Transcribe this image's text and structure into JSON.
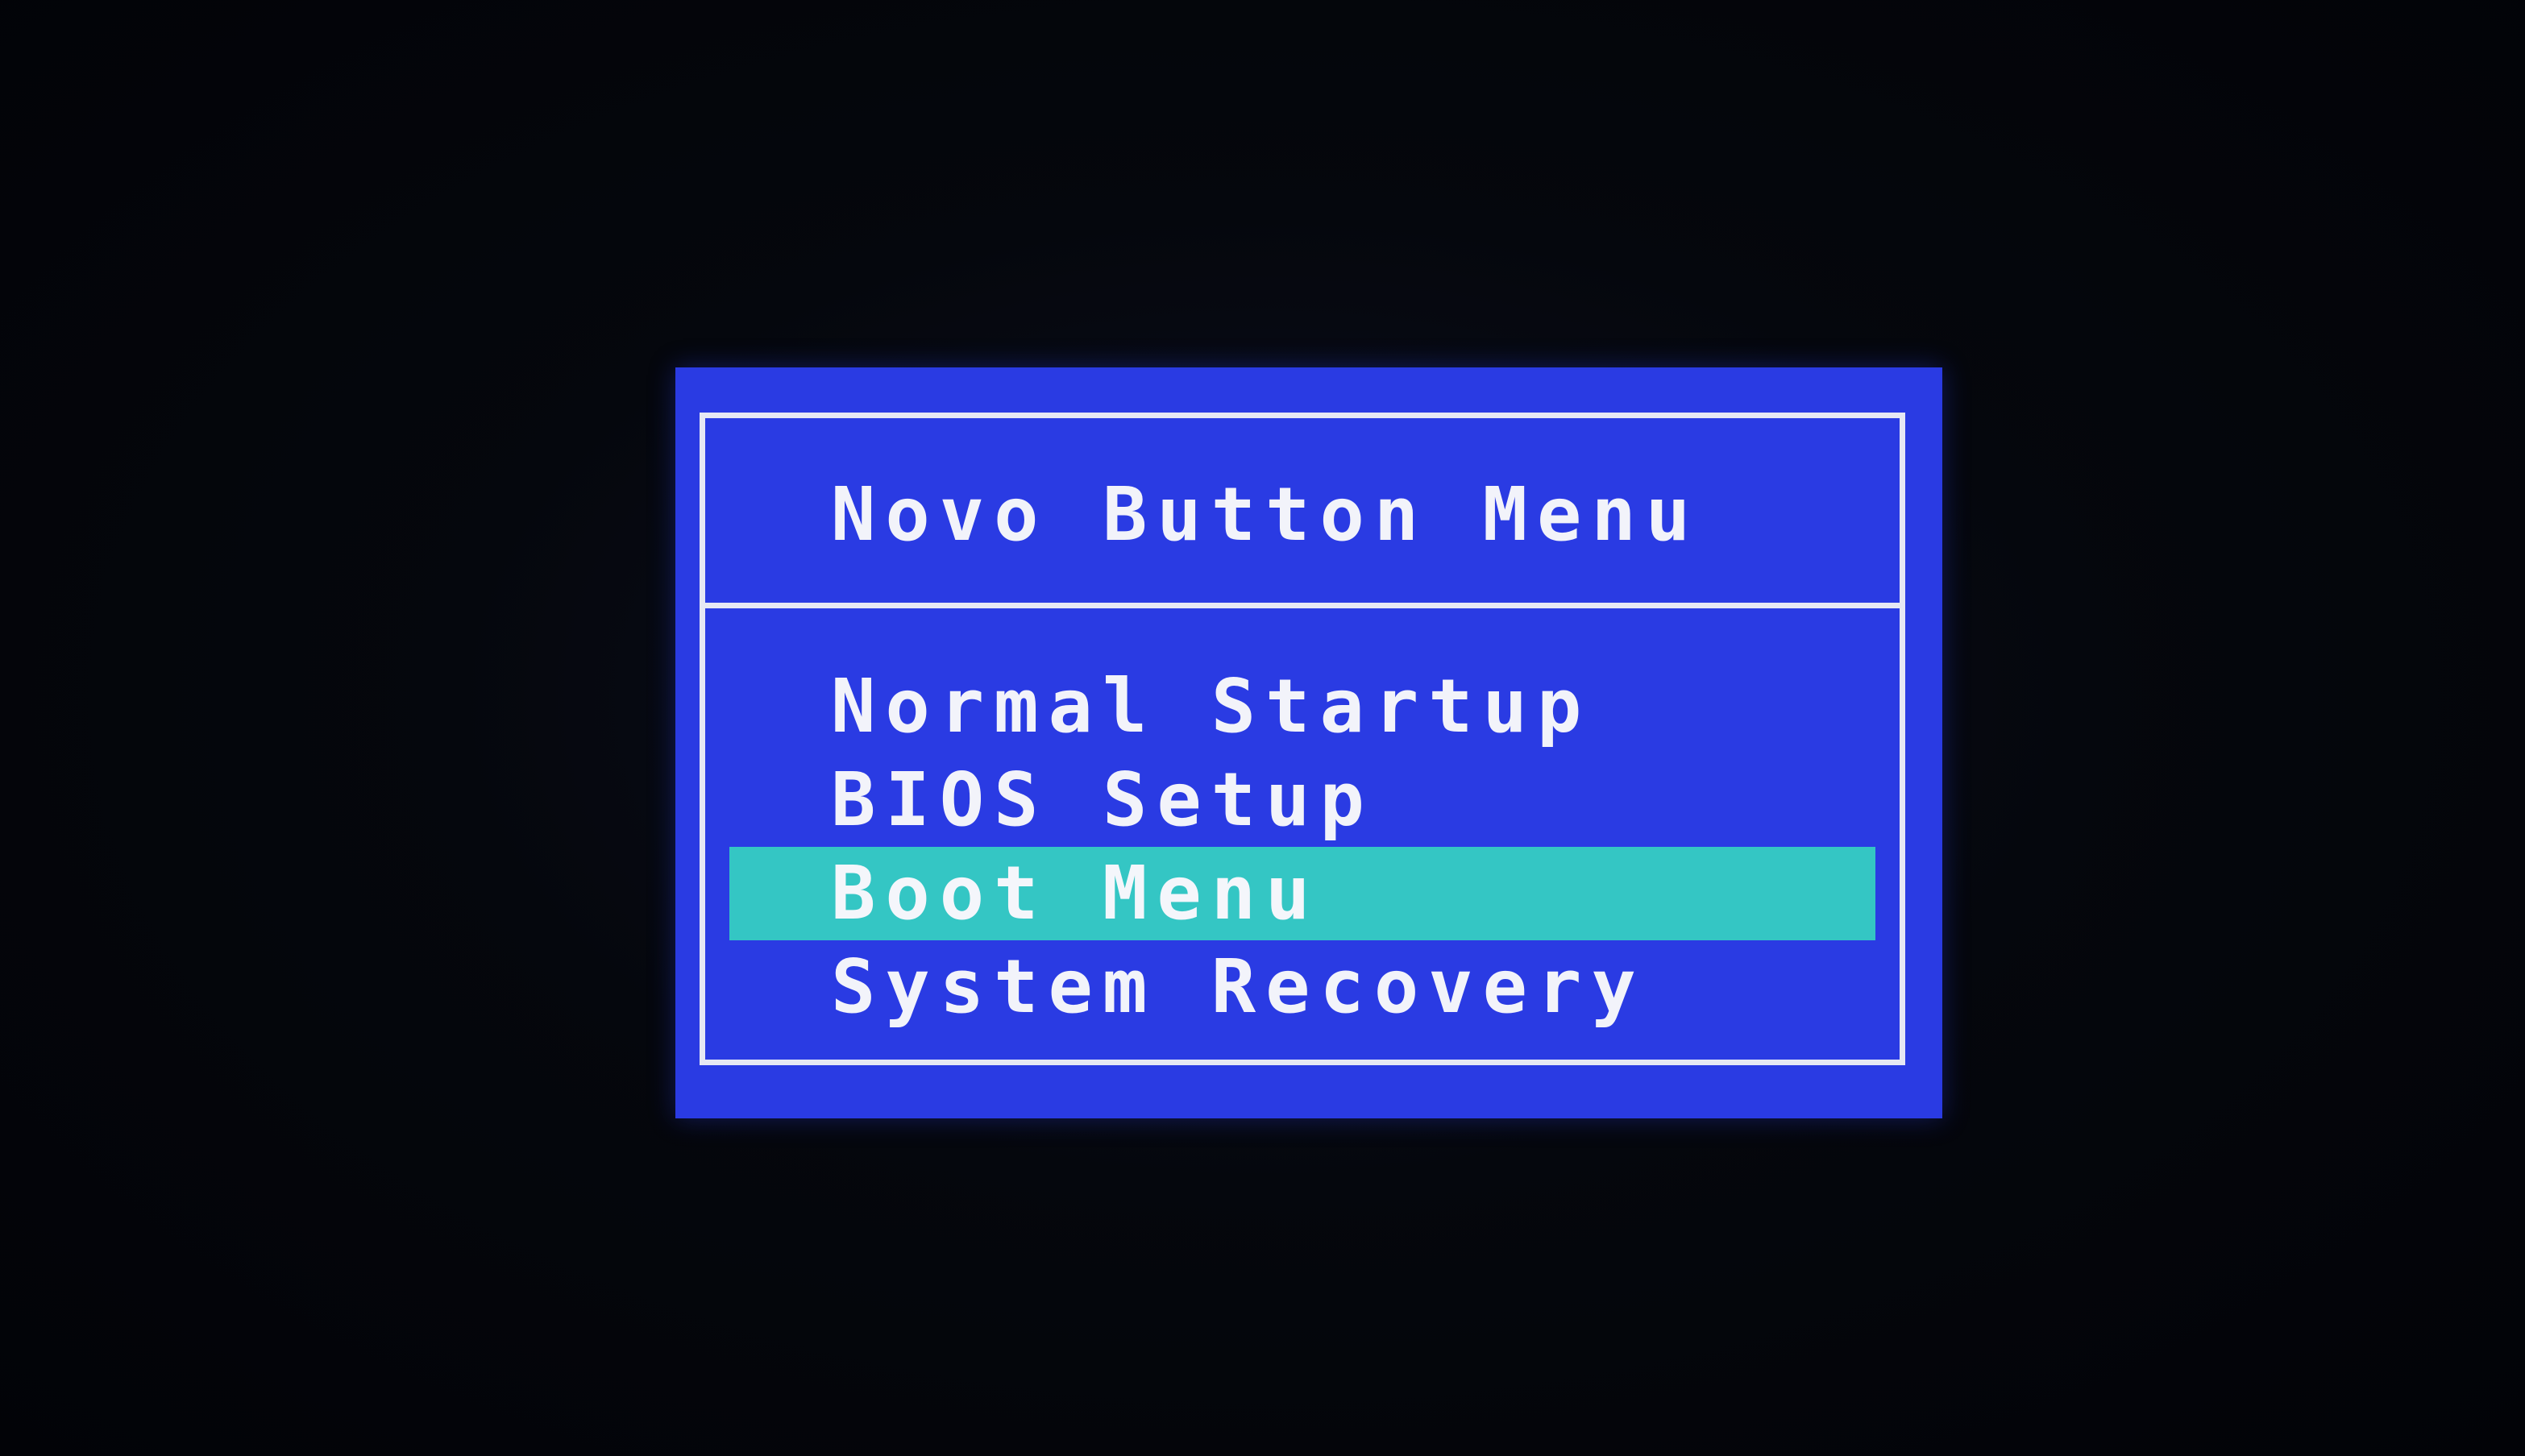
{
  "dialog": {
    "title": "Novo Button Menu",
    "items": [
      {
        "label": "Normal Startup",
        "selected": false
      },
      {
        "label": "BIOS Setup",
        "selected": false
      },
      {
        "label": "Boot Menu",
        "selected": true
      },
      {
        "label": "System Recovery",
        "selected": false
      }
    ]
  },
  "colors": {
    "background": "#03050a",
    "dialog_blue": "#2a3be3",
    "border": "#e6e8f4",
    "highlight": "#34c6c4",
    "text": "#f2f3fa"
  }
}
